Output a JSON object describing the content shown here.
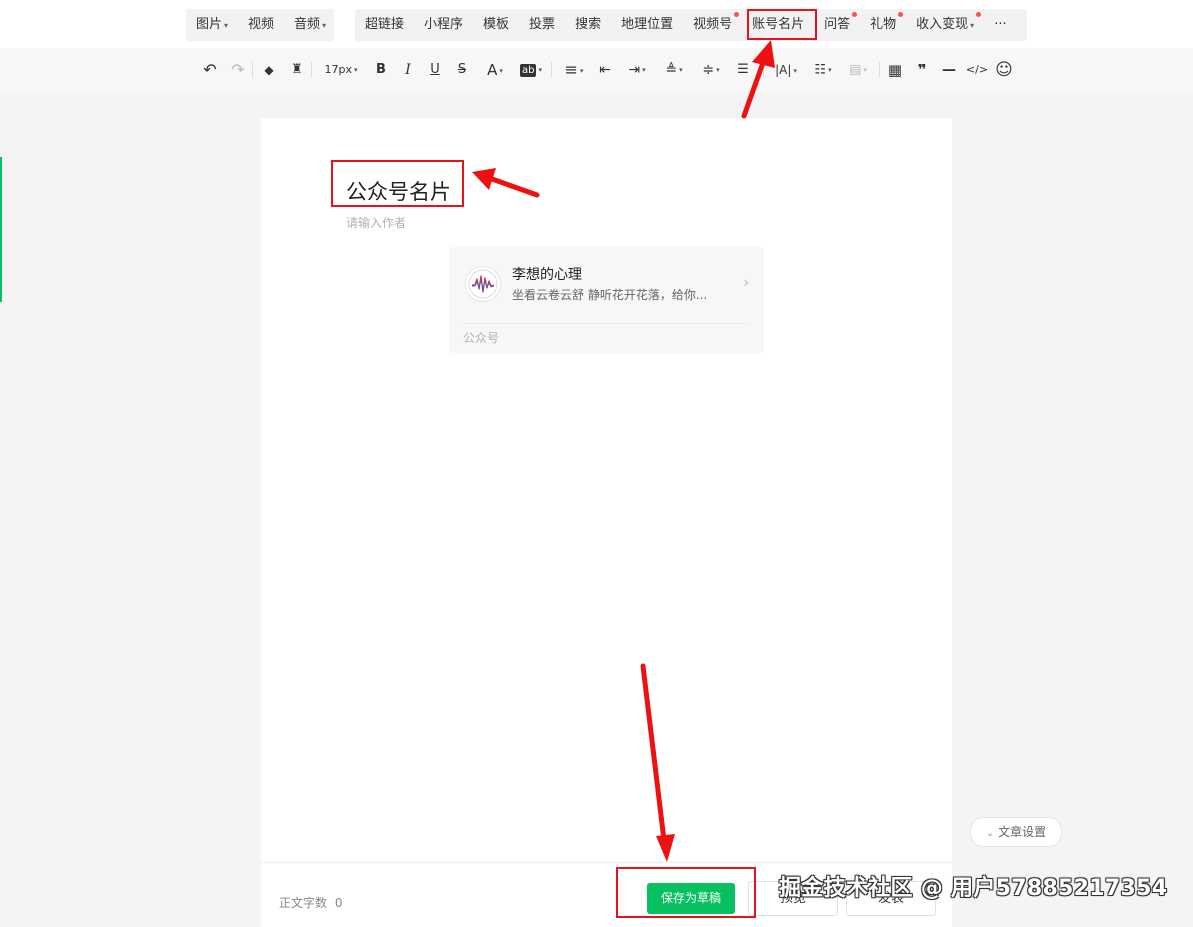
{
  "insert_menu": {
    "group1": [
      {
        "label": "图片",
        "dropdown": true
      },
      {
        "label": "视频",
        "dropdown": false
      },
      {
        "label": "音频",
        "dropdown": true
      }
    ],
    "group2": [
      {
        "label": "超链接",
        "dot": false,
        "dropdown": false
      },
      {
        "label": "小程序",
        "dot": false,
        "dropdown": false
      },
      {
        "label": "模板",
        "dot": false,
        "dropdown": false
      },
      {
        "label": "投票",
        "dot": false,
        "dropdown": false
      },
      {
        "label": "搜索",
        "dot": false,
        "dropdown": false
      },
      {
        "label": "地理位置",
        "dot": false,
        "dropdown": false
      },
      {
        "label": "视频号",
        "dot": true,
        "dropdown": false
      },
      {
        "label": "账号名片",
        "dot": false,
        "dropdown": false
      },
      {
        "label": "问答",
        "dot": true,
        "dropdown": false
      },
      {
        "label": "礼物",
        "dot": true,
        "dropdown": false
      },
      {
        "label": "收入变现",
        "dot": true,
        "dropdown": true
      }
    ],
    "more_label": "···"
  },
  "format_toolbar": {
    "undo": "↶",
    "redo": "↷",
    "eraser": "◆",
    "format_painter": "♜",
    "font_size": "17px",
    "bold": "B",
    "italic": "I",
    "underline": "U",
    "strike": "S",
    "font_color": "A",
    "highlight": "ab",
    "align": "≡",
    "indent_out": "⇤",
    "indent_in": "⇥",
    "line_spacing": "≜",
    "para_spacing": "≑",
    "text_indent": "☰",
    "letter_spacing": "|A|",
    "list": "☷",
    "image_align": "▤",
    "table": "▦",
    "quote": "❞",
    "hr": "—",
    "code": "</>",
    "emoji": "☺"
  },
  "editor": {
    "title": "公众号名片",
    "author_placeholder": "请输入作者"
  },
  "card": {
    "name": "李想的心理",
    "description": "坐看云卷云舒 静听花开花落，给你...",
    "type": "公众号"
  },
  "footer": {
    "word_count_label": "正文字数",
    "word_count": "0",
    "save_draft": "保存为草稿",
    "preview": "预览",
    "publish": "发表"
  },
  "article_settings": "文章设置",
  "watermark": "掘金技术社区 @ 用户57885217354",
  "colors": {
    "accent_green": "#07c160",
    "annotation_red": "#e8131a",
    "notice_dot": "#fa5151"
  }
}
